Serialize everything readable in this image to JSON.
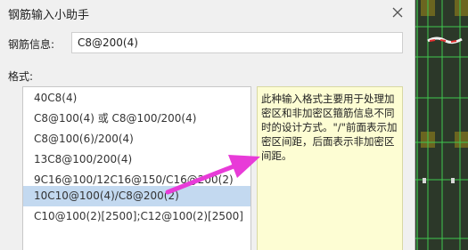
{
  "dialog": {
    "title": "钢筋输入小助手"
  },
  "info": {
    "label": "钢筋信息:",
    "value": "C8@200(4)"
  },
  "format": {
    "label": "格式:",
    "items": [
      "40C8(4)",
      "C8@100(4) 或 C8@100/200(4)",
      "C8@100(6)/200(4)",
      "13C8@100/200(4)",
      "9C16@100/12C16@150/C16@200(2)",
      "10C10@100(4)/C8@200(2)",
      "C10@100(2)[2500];C12@100(2)[2500]"
    ],
    "selected_index": 5
  },
  "description": "此种输入格式主要用于处理加密区和非加密区箍筋信息不同时的设计方式。\"/\"前面表示加密区间距，后面表示非加密区间距。",
  "colors": {
    "selection": "#c3d9f0",
    "description_bg": "#fdfdd3",
    "arrow": "#e83bd8",
    "cad_green": "#37c84a"
  }
}
